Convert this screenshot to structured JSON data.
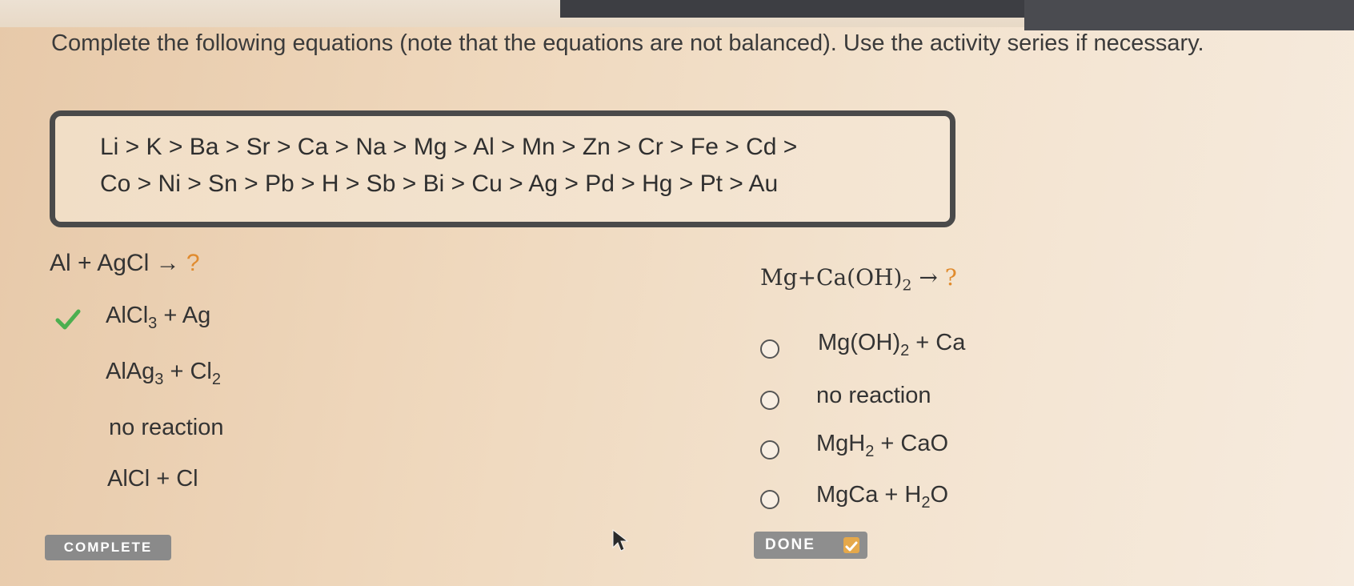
{
  "prompt": "Complete the following equations (note that the equations are not balanced). Use the activity series if necessary.",
  "activity_series": {
    "line1": "Li > K > Ba > Sr > Ca > Na > Mg > Al > Mn > Zn > Cr > Fe > Cd >",
    "line2": "Co > Ni > Sn > Pb > H > Sb > Bi > Cu > Ag > Pd > Hg > Pt > Au"
  },
  "question1": {
    "reactants": "Al + AgCl",
    "arrow": "→",
    "unknown": "?",
    "options": [
      {
        "a": "AlCl",
        "a_sub": "3",
        "b": " + Ag",
        "b_sub": "",
        "selected": true
      },
      {
        "a": "AlAg",
        "a_sub": "3",
        "b": " + Cl",
        "b_sub": "2",
        "selected": false
      },
      {
        "a": "no reaction",
        "a_sub": "",
        "b": "",
        "b_sub": "",
        "selected": false
      },
      {
        "a": "AlCl + Cl",
        "a_sub": "",
        "b": "",
        "b_sub": "",
        "selected": false
      }
    ]
  },
  "question2": {
    "reactants_a": "Mg+Ca(OH)",
    "reactants_sub": "2",
    "arrow": "→",
    "unknown": "?",
    "options": [
      {
        "a": "Mg(OH)",
        "a_sub": "2",
        "b": " + Ca",
        "b_sub": "",
        "b2": ""
      },
      {
        "a": "no reaction",
        "a_sub": "",
        "b": "",
        "b_sub": "",
        "b2": ""
      },
      {
        "a": "MgH",
        "a_sub": "2",
        "b": " + CaO",
        "b_sub": "",
        "b2": ""
      },
      {
        "a": "MgCa + H",
        "a_sub": "2",
        "b": "O",
        "b_sub": "",
        "b2": ""
      }
    ]
  },
  "buttons": {
    "complete": "COMPLETE",
    "done": "DONE"
  },
  "colors": {
    "check": "#4caf50",
    "accent": "#e08b2e"
  }
}
